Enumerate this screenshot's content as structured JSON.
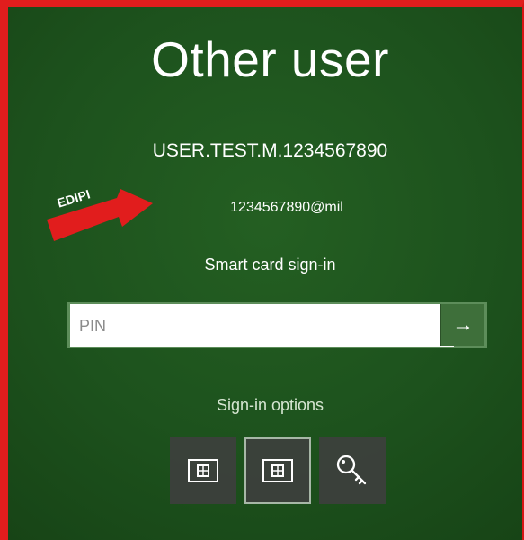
{
  "screen": {
    "title": "Other user",
    "username": "USER.TEST.M.1234567890",
    "edipi_value": "1234567890@mil",
    "smartcard_label": "Smart card sign-in"
  },
  "pin": {
    "placeholder": "PIN",
    "submit_symbol": "→"
  },
  "signin": {
    "title": "Sign-in options",
    "options": [
      {
        "name": "smart-card-option",
        "icon": "smart-card-icon"
      },
      {
        "name": "smart-card-option-selected",
        "icon": "smart-card-icon"
      },
      {
        "name": "key-option",
        "icon": "key-icon"
      }
    ]
  },
  "annotation": {
    "label": "EDIPI",
    "color": "#e11d1d"
  },
  "colors": {
    "background": "#1d521d",
    "accent": "#3e6f3a",
    "frame": "#e11d1d"
  }
}
